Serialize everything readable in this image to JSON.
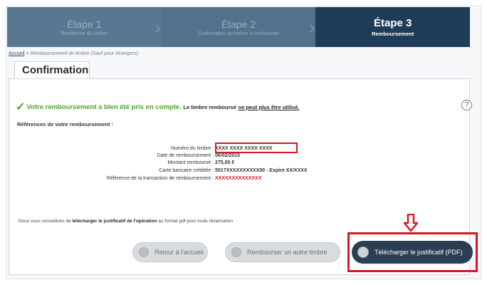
{
  "stepper": {
    "steps": [
      {
        "title": "Étape 1",
        "subtitle": "Recherche du timbre"
      },
      {
        "title": "Étape 2",
        "subtitle": "Confirmation du timbre à rembourser"
      },
      {
        "title": "Étape 3",
        "subtitle": "Remboursement"
      }
    ],
    "active_index": 2
  },
  "breadcrumb": {
    "home": "Accueil",
    "separator": " > ",
    "current": "Remboursement de timbre",
    "note": "(Sauf pour étrangers)"
  },
  "tab": {
    "label": "Confirmation"
  },
  "success": {
    "headline": "Votre remboursement a bien été pris en compte.",
    "note": "Le timbre remboursé",
    "warning": "ne peut plus être utilisé."
  },
  "help": {
    "icon": "question-mark-icon",
    "glyph": "?"
  },
  "references": {
    "title": "Références de votre remboursement :",
    "rows": [
      {
        "label": "Numéro du timbre :",
        "value": "XXXX XXXX XXXX XXXX"
      },
      {
        "label": "Date de remboursement :",
        "value": "06/02/2015"
      },
      {
        "label": "Montant remboursé :",
        "value": "275,00 €"
      },
      {
        "label": "Carte bancaire créditée :",
        "value": "5017XXXXXXXXXX00 - Expire  XX/XXXX"
      },
      {
        "label": "Référence de la transaction de remboursement :",
        "value": "XXXXXXXXXXXXXX"
      }
    ]
  },
  "advice": {
    "pre": "Nous vous conseillons de ",
    "bold": "télécharger le justificatif de l'opération",
    "post": " au format pdf pour toute réclamation"
  },
  "buttons": {
    "home": "Retour à l'accueil",
    "another": "Rembourser un autre timbre",
    "download": "Télécharger le justificatif (PDF)"
  },
  "colors": {
    "stepper_active": "#1e3c58",
    "stepper_inactive": "#54708a",
    "success_green": "#4aa52e",
    "highlight_red": "#d21a26",
    "download_button": "#2a3e55"
  }
}
